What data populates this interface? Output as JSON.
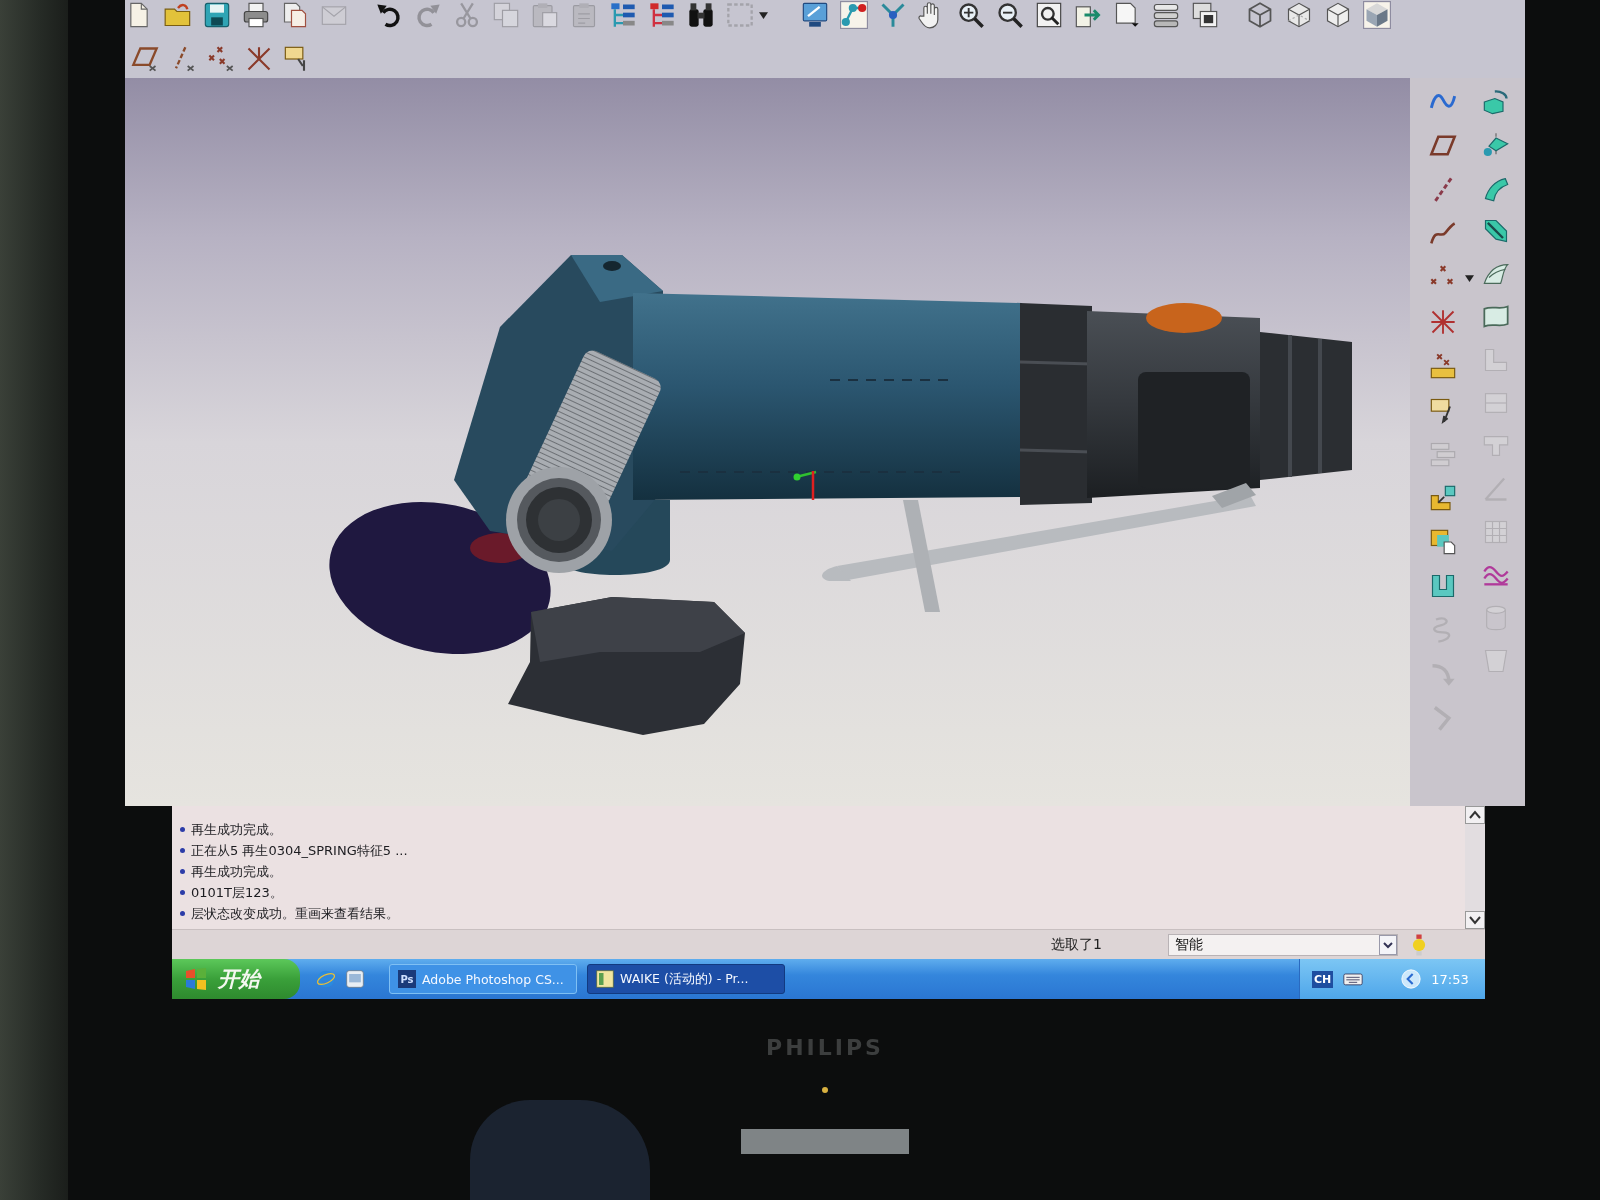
{
  "toolbar": {
    "rows": [
      [
        {
          "disabled": false,
          "pressed": false
        },
        {
          "disabled": false,
          "pressed": false
        },
        {
          "disabled": false,
          "pressed": false
        },
        {
          "disabled": false,
          "pressed": false
        },
        {
          "disabled": false,
          "pressed": false
        },
        {
          "disabled": true,
          "pressed": false
        },
        {
          "disabled": false,
          "pressed": false
        },
        {
          "disabled": true,
          "pressed": false
        },
        {
          "disabled": true,
          "pressed": false
        },
        {
          "disabled": true,
          "pressed": false
        },
        {
          "disabled": true,
          "pressed": false
        },
        {
          "disabled": true,
          "pressed": false
        },
        {
          "disabled": false,
          "pressed": false
        },
        {
          "disabled": false,
          "pressed": false
        },
        {
          "disabled": false,
          "pressed": false
        },
        {
          "disabled": true,
          "pressed": false
        },
        {
          "disabled": false,
          "pressed": false
        },
        {
          "disabled": false,
          "pressed": true
        },
        {
          "disabled": false,
          "pressed": false
        },
        {
          "disabled": false,
          "pressed": false
        },
        {
          "disabled": false,
          "pressed": false
        },
        {
          "disabled": false,
          "pressed": false
        },
        {
          "disabled": false,
          "pressed": false
        },
        {
          "disabled": false,
          "pressed": false
        },
        {
          "disabled": false,
          "pressed": false
        },
        {
          "disabled": false,
          "pressed": false
        },
        {
          "disabled": false,
          "pressed": false
        },
        {
          "disabled": false,
          "pressed": false
        },
        {
          "disabled": false,
          "pressed": false
        },
        {
          "disabled": false,
          "pressed": false
        },
        {
          "disabled": false,
          "pressed": true
        }
      ],
      [
        {
          "disabled": false
        },
        {
          "disabled": false
        },
        {
          "disabled": false
        },
        {
          "disabled": false
        },
        {
          "disabled": false
        }
      ]
    ]
  },
  "right_toolbar": {
    "columns": [
      [
        {
          "disabled": false
        },
        {
          "disabled": false
        },
        {
          "disabled": false
        },
        {
          "disabled": false
        },
        {
          "disabled": false
        },
        {
          "disabled": false
        },
        {
          "disabled": false
        },
        {
          "disabled": false
        },
        {
          "disabled": true
        },
        {
          "disabled": false
        },
        {
          "disabled": false
        },
        {
          "disabled": false
        },
        {
          "disabled": true
        },
        {
          "disabled": true
        },
        {
          "disabled": true
        }
      ],
      [
        {
          "disabled": false
        },
        {
          "disabled": false
        },
        {
          "disabled": false
        },
        {
          "disabled": false
        },
        {
          "disabled": false
        },
        {
          "disabled": false
        },
        {
          "disabled": true
        },
        {
          "disabled": true
        },
        {
          "disabled": true
        },
        {
          "disabled": true
        },
        {
          "disabled": true
        },
        {
          "disabled": false
        },
        {
          "disabled": true
        },
        {
          "disabled": true
        }
      ]
    ]
  },
  "messages": [
    "再生成功完成。",
    "正在从5 再生0304_SPRING特征5 ...",
    "再生成功完成。",
    "0101T层123。",
    "层状态改变成功。重画来查看结果。"
  ],
  "status_bar": {
    "selection": "选取了1",
    "filter": {
      "value": "智能"
    }
  },
  "taskbar": {
    "start": "开始",
    "tasks": [
      {
        "badge": "Ps",
        "label": "Adobe Photoshop CS...",
        "selected": false
      },
      {
        "label": "WAIKE (活动的) - Pr...",
        "selected": true
      }
    ],
    "language": "CH",
    "clock": "17:53"
  },
  "monitor": {
    "brand": "PHILIPS"
  }
}
